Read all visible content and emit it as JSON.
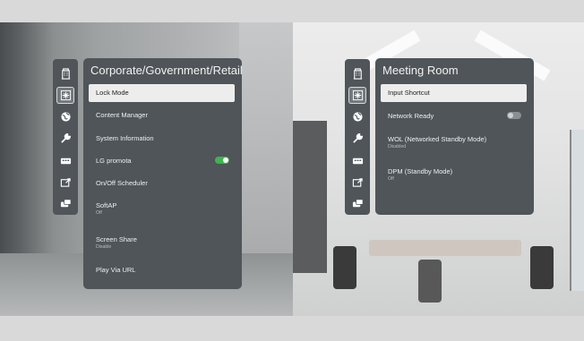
{
  "left_screen": {
    "title": "Corporate/Government/Retail",
    "rail_icons": [
      "building-icon",
      "snowflake-icon",
      "globe-icon",
      "wrench-icon",
      "remote-control-icon",
      "external-display-icon",
      "toggle-switch-icon"
    ],
    "items": [
      {
        "label": "Lock Mode",
        "sub": ""
      },
      {
        "label": "Content Manager",
        "sub": ""
      },
      {
        "label": "System Information",
        "sub": ""
      },
      {
        "label": "LG promota",
        "sub": "",
        "toggle": "on"
      },
      {
        "label": "On/Off Scheduler",
        "sub": ""
      },
      {
        "label": "SoftAP",
        "sub": "Off"
      },
      {
        "label": "Screen Share",
        "sub": "Disable"
      },
      {
        "label": "Play Via URL",
        "sub": ""
      }
    ]
  },
  "right_screen": {
    "title": "Meeting Room",
    "rail_icons": [
      "building-icon",
      "snowflake-icon",
      "globe-icon",
      "wrench-icon",
      "remote-control-icon",
      "external-display-icon",
      "toggle-switch-icon"
    ],
    "items": [
      {
        "label": "Input Shortcut",
        "sub": ""
      },
      {
        "label": "Network Ready",
        "sub": "",
        "toggle": "off"
      },
      {
        "label": "WOL (Networked Standby Mode)",
        "sub": "Disabled"
      },
      {
        "label": "DPM (Standby Mode)",
        "sub": "Off"
      }
    ]
  },
  "colors": {
    "panel": "#4f5559",
    "selected": "#ededee",
    "toggle_on": "#3fb34f",
    "toggle_off": "#8a8f92"
  }
}
